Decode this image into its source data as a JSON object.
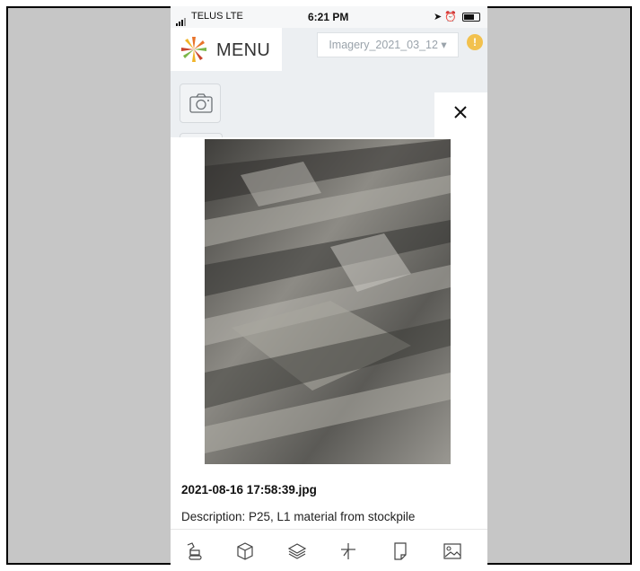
{
  "status_bar": {
    "carrier": "TELUS  LTE",
    "time": "6:21 PM",
    "icons": [
      "location-arrow-icon",
      "alarm-icon",
      "battery-icon"
    ]
  },
  "header": {
    "menu_label": "MENU",
    "imagery_select": "Imagery_2021_03_12 ▾",
    "alert_badge": "!",
    "alert_color": "#f2c14e"
  },
  "photo_viewer": {
    "close_label": "×",
    "filename": "2021-08-16 17:58:39.jpg",
    "description": "Description: P25, L1 material from stockpile"
  },
  "toolbar": {
    "items": [
      "excavator-icon",
      "cube-icon",
      "layers-icon",
      "plus-cross-icon",
      "note-icon",
      "image-icon"
    ]
  },
  "colors": {
    "frame_bg": "#c6c6c6",
    "app_bg": "#eceff2",
    "logo_orange": "#e8732a",
    "logo_green": "#7ab648",
    "logo_gold": "#f0b428",
    "logo_red": "#c8432b"
  }
}
